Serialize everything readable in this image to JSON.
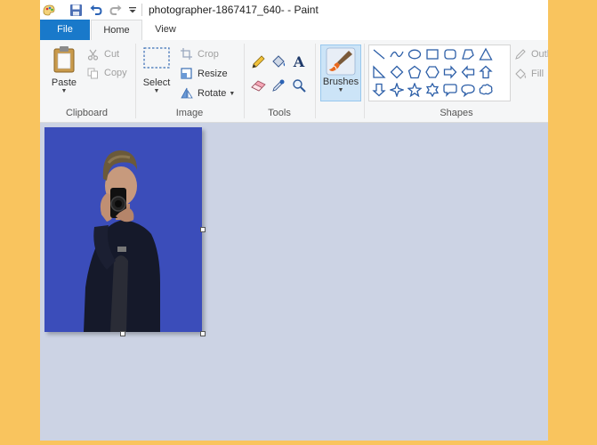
{
  "window": {
    "title": "photographer-1867417_640- - Paint"
  },
  "quick_access": {
    "icons": [
      "paint-app-icon",
      "save-icon",
      "undo-icon",
      "redo-icon",
      "customize-dropdown-icon"
    ]
  },
  "tabs": [
    {
      "label": "File"
    },
    {
      "label": "Home"
    },
    {
      "label": "View"
    }
  ],
  "ribbon": {
    "clipboard": {
      "label": "Clipboard",
      "paste": "Paste",
      "cut": "Cut",
      "copy": "Copy"
    },
    "image": {
      "label": "Image",
      "select": "Select",
      "crop": "Crop",
      "resize": "Resize",
      "rotate": "Rotate"
    },
    "tools": {
      "label": "Tools",
      "icons": [
        "pencil-icon",
        "fill-bucket-icon",
        "text-icon",
        "eraser-icon",
        "color-picker-icon",
        "magnifier-icon"
      ]
    },
    "brushes": {
      "label": "Brushes"
    },
    "shapes": {
      "label": "Shapes",
      "outline": "Outl",
      "fill": "Fill"
    }
  },
  "colors": {
    "accent": "#1979CA",
    "canvas_bg": "#CCD3E4",
    "image_bg": "#3B4DBA",
    "page_bg": "#F9C45E"
  }
}
